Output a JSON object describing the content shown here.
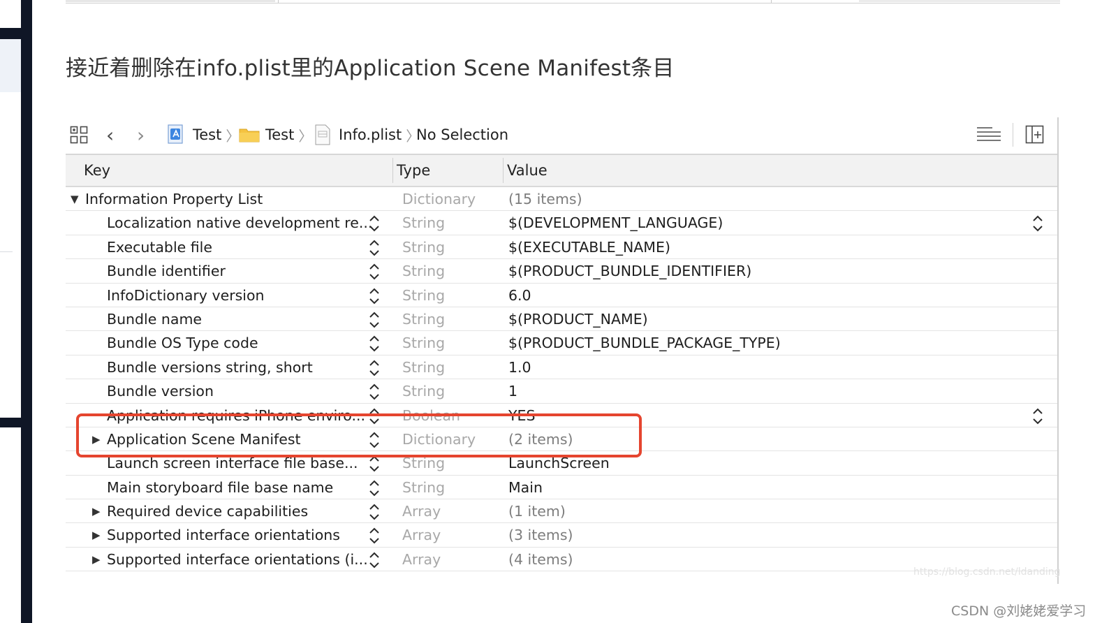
{
  "heading": "接近着删除在info.plist里的Application Scene Manifest条目",
  "jumpbar": {
    "crumbs": [
      {
        "label": "Test",
        "icon": "project-icon"
      },
      {
        "label": "Test",
        "icon": "folder-icon"
      },
      {
        "label": "Info.plist",
        "icon": "plist-file-icon"
      },
      {
        "label": "No Selection",
        "icon": ""
      }
    ]
  },
  "columns": {
    "key": "Key",
    "type": "Type",
    "value": "Value"
  },
  "rows": [
    {
      "key": "Information Property List",
      "type": "Dictionary",
      "value": "(15 items)",
      "expandable": true,
      "expanded": true,
      "top": true
    },
    {
      "key": "Localization native development re...",
      "type": "String",
      "value": "$(DEVELOPMENT_LANGUAGE)"
    },
    {
      "key": "Executable file",
      "type": "String",
      "value": "$(EXECUTABLE_NAME)"
    },
    {
      "key": "Bundle identifier",
      "type": "String",
      "value": "$(PRODUCT_BUNDLE_IDENTIFIER)"
    },
    {
      "key": "InfoDictionary version",
      "type": "String",
      "value": "6.0"
    },
    {
      "key": "Bundle name",
      "type": "String",
      "value": "$(PRODUCT_NAME)"
    },
    {
      "key": "Bundle OS Type code",
      "type": "String",
      "value": "$(PRODUCT_BUNDLE_PACKAGE_TYPE)"
    },
    {
      "key": "Bundle versions string, short",
      "type": "String",
      "value": "1.0"
    },
    {
      "key": "Bundle version",
      "type": "String",
      "value": "1"
    },
    {
      "key": "Application requires iPhone enviro...",
      "type": "Boolean",
      "value": "YES"
    },
    {
      "key": "Application Scene Manifest",
      "type": "Dictionary",
      "value": "(2 items)",
      "expandable": true
    },
    {
      "key": "Launch screen interface file base...",
      "type": "String",
      "value": "LaunchScreen"
    },
    {
      "key": "Main storyboard file base name",
      "type": "String",
      "value": "Main"
    },
    {
      "key": "Required device capabilities",
      "type": "Array",
      "value": "(1 item)",
      "expandable": true
    },
    {
      "key": "Supported interface orientations",
      "type": "Array",
      "value": "(3 items)",
      "expandable": true
    },
    {
      "key": "Supported interface orientations (i...",
      "type": "Array",
      "value": "(4 items)",
      "expandable": true
    }
  ],
  "watermark_faint": "https://blog.csdn.net/ldanding",
  "watermark": "CSDN @刘姥姥爱学习",
  "accent_highlight": "#e5452f"
}
